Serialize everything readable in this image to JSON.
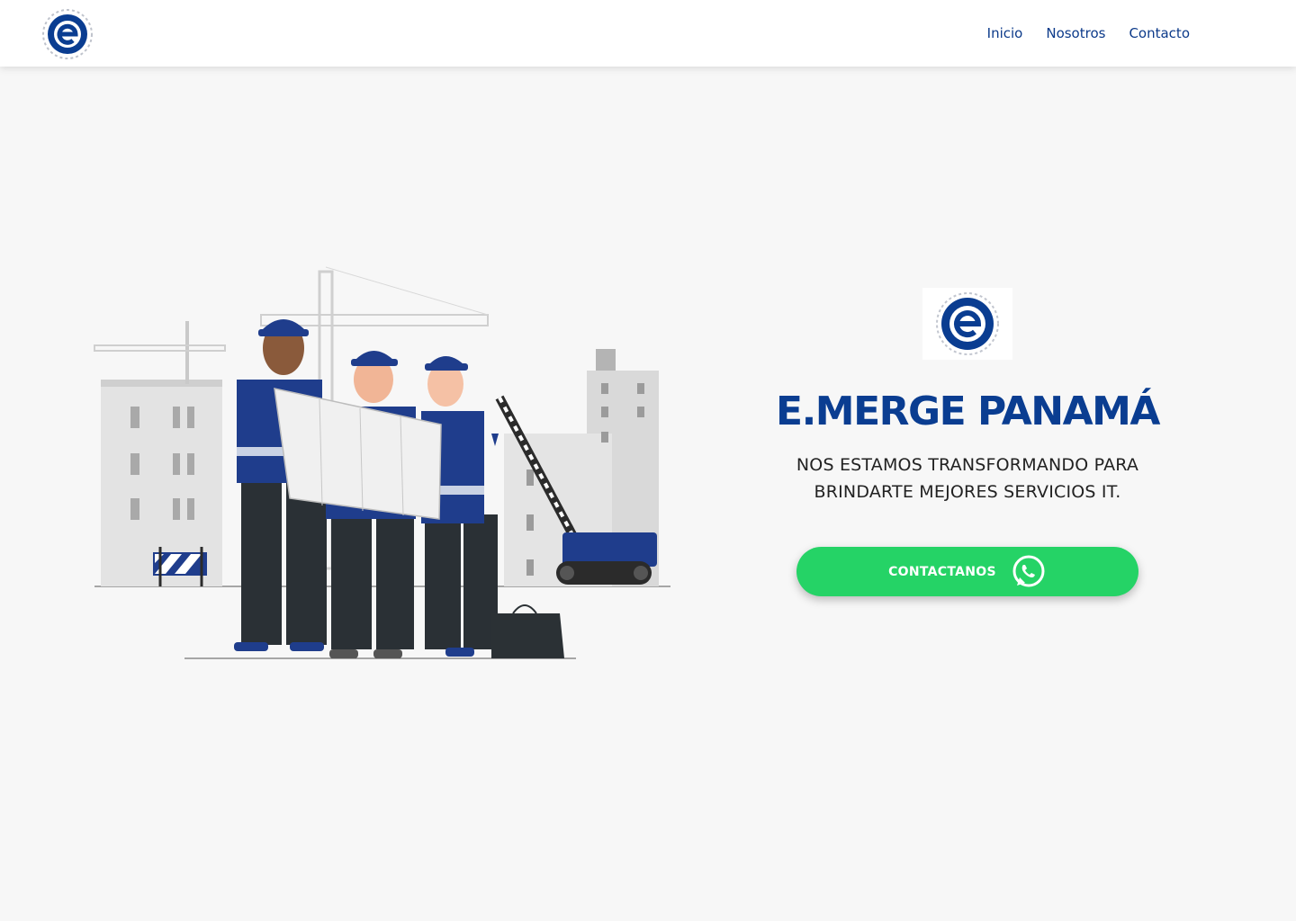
{
  "header": {
    "logo_name": "emerge-logo",
    "nav": [
      {
        "label": "Inicio"
      },
      {
        "label": "Nosotros"
      },
      {
        "label": "Contacto"
      }
    ]
  },
  "hero": {
    "title": "E.MERGE PANAMÁ",
    "subtitle_line1": "NOS ESTAMOS TRANSFORMANDO PARA",
    "subtitle_line2": "BRINDARTE MEJORES SERVICIOS IT.",
    "cta_label": "CONTACTANOS",
    "cta_icon": "whatsapp-icon"
  },
  "colors": {
    "brand_blue": "#0a3d91",
    "nav_blue": "#0c3a8a",
    "whatsapp_green": "#25d366",
    "background": "#f7f7f7"
  }
}
